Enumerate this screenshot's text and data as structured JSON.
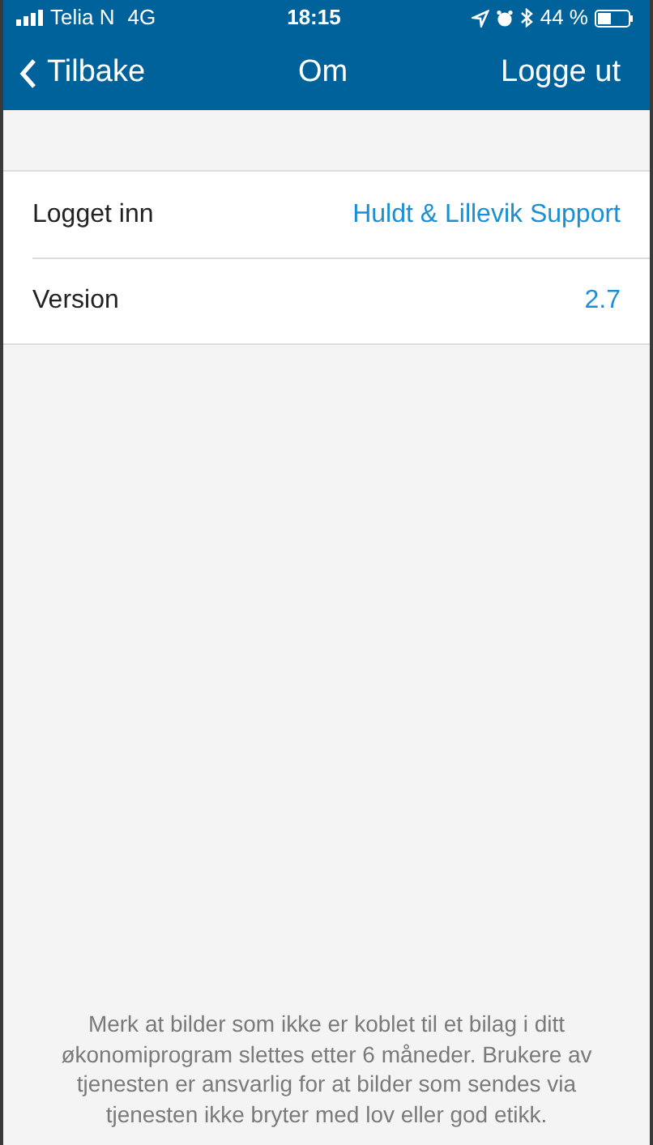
{
  "status_bar": {
    "carrier": "Telia N",
    "network": "4G",
    "time": "18:15",
    "battery_percent": "44 %"
  },
  "nav": {
    "back": "Tilbake",
    "title": "Om",
    "action": "Logge ut"
  },
  "rows": [
    {
      "label": "Logget inn",
      "value": "Huldt & Lillevik Support"
    },
    {
      "label": "Version",
      "value": "2.7"
    }
  ],
  "footer": "Merk at bilder som ikke er koblet til et bilag i ditt økonomiprogram slettes etter 6 måneder. Brukere av tjenesten er ansvarlig for at bilder som sendes via tjenesten ikke bryter med lov eller god etikk."
}
